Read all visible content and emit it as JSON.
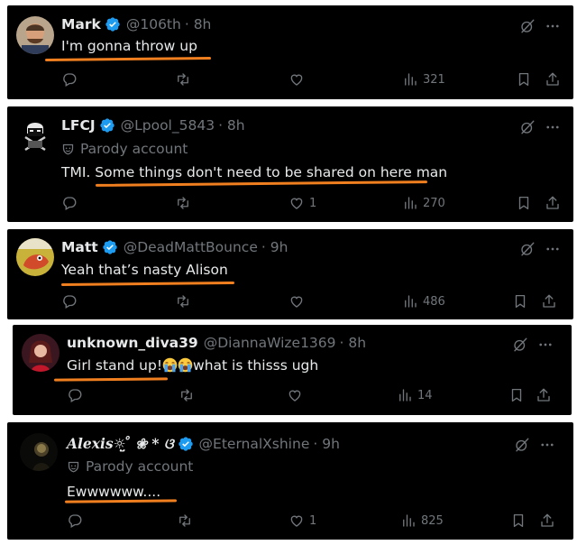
{
  "posts": [
    {
      "name": "Mark",
      "handle": "@106th",
      "time": "· 8h",
      "text": "I'm gonna throw up",
      "parody": "",
      "stats": {
        "replies": "",
        "reposts": "",
        "likes": "",
        "views": "321"
      }
    },
    {
      "name": "LFCJ",
      "handle": "@Lpool_5843",
      "time": "· 8h",
      "parody": "Parody account",
      "text": "TMI. Some things don't need to be shared on here man",
      "stats": {
        "replies": "",
        "reposts": "",
        "likes": "1",
        "views": "270"
      }
    },
    {
      "name": "Matt",
      "handle": "@DeadMattBounce",
      "time": "· 9h",
      "parody": "",
      "text": "Yeah that’s nasty Alison",
      "stats": {
        "replies": "",
        "reposts": "",
        "likes": "",
        "views": "486"
      }
    },
    {
      "name": "unknown_diva39",
      "handle": "@DiannaWize1369",
      "time": "· 8h",
      "parody": "",
      "text_before": "Girl stand up!",
      "text_after": "what is thisss ugh",
      "emoji": "loudly-crying-face",
      "stats": {
        "replies": "",
        "reposts": "",
        "likes": "",
        "views": "14"
      }
    },
    {
      "name": "𝑨𝒍𝒆𝒙𝒊𝒔☼̤̮ ̊ ❀ * ଓ",
      "handle": "@EternalXshine",
      "time": "· 9h",
      "parody": "Parody account",
      "text": "Ewwwwww....",
      "stats": {
        "replies": "",
        "reposts": "",
        "likes": "1",
        "views": "825"
      }
    }
  ],
  "colors": {
    "background": "#000000",
    "text": "#e7e9ea",
    "muted": "#71767b",
    "verified": "#1d9bf0",
    "underline": "#f07f20"
  },
  "icons": [
    "verified-icon",
    "grok-icon",
    "more-icon",
    "reply-icon",
    "repost-icon",
    "like-icon",
    "views-icon",
    "bookmark-icon",
    "share-icon",
    "parody-icon"
  ]
}
